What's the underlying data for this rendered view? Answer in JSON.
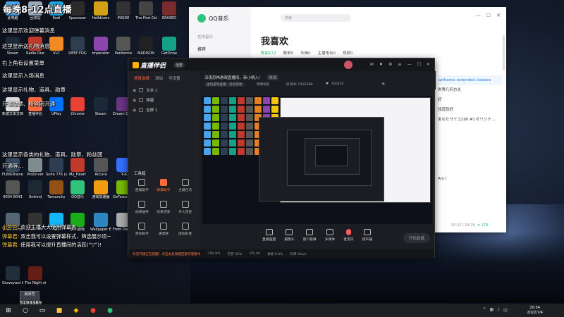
{
  "overlay": {
    "title": "每晚8-12点直播",
    "tips": [
      "这里显示欢迎弹幕消息",
      "这里显示送礼物消息",
      "右上角有设置菜单",
      "这里显示入场消息",
      "这里显示礼物、道具、勋章",
      "开通勋章、粉丝团开通",
      "这里显示各类的礼物、道具、勋章、粉丝团",
      "开通等…"
    ]
  },
  "desktop_icons": [
    {
      "label": "此电脑",
      "color": "#4aa3e8"
    },
    {
      "label": "回收站",
      "color": "#9aa8b8"
    },
    {
      "label": "Kodi",
      "color": "#1ba1e2"
    },
    {
      "label": "Spacewar",
      "color": "#2b2b2b"
    },
    {
      "label": "Helldivers",
      "color": "#d4a017"
    },
    {
      "label": "INSIDE",
      "color": "#333"
    },
    {
      "label": "The First Odyssey",
      "color": "#444"
    },
    {
      "label": "ERASED",
      "color": "#7a2b2b"
    },
    {
      "label": "Steam",
      "color": "#1b2838"
    },
    {
      "label": "Radio One",
      "color": "#c0392b"
    },
    {
      "label": "VLC",
      "color": "#f08a24"
    },
    {
      "label": "DEEP FOG",
      "color": "#2c3e50"
    },
    {
      "label": "Imperator",
      "color": "#8e44ad"
    },
    {
      "label": "Penitence",
      "color": "#555"
    },
    {
      "label": "MADISON",
      "color": "#222"
    },
    {
      "label": "GetOnne",
      "color": "#16a085"
    },
    {
      "label": "新建文本文档",
      "color": "#ddd"
    },
    {
      "label": "直播伴侣",
      "color": "#ff6a3d"
    },
    {
      "label": "UPlay",
      "color": "#0070ff"
    },
    {
      "label": "Chrome",
      "color": "#e94235"
    },
    {
      "label": "Steam",
      "color": "#1b2838"
    },
    {
      "label": "Dream Disorder",
      "color": "#6c3483"
    },
    {
      "label": "The Ghost",
      "color": "#444"
    },
    {
      "label": "优酷",
      "color": "#1e90ff"
    },
    {
      "label": "FLINGTrainer",
      "color": "#34495e"
    },
    {
      "label": "ProDriver",
      "color": "#7f8c8d"
    },
    {
      "label": "Suite 776 Launcher",
      "color": "#2c3e50"
    },
    {
      "label": "My_Heart",
      "color": "#c0392b"
    },
    {
      "label": "Accura",
      "color": "#555"
    },
    {
      "label": "飞书",
      "color": "#3370ff"
    },
    {
      "label": "YY直播",
      "color": "#f1c40f"
    },
    {
      "label": "UNITY",
      "color": "#222"
    },
    {
      "label": "8034 8043",
      "color": "#555"
    },
    {
      "label": "Unikind",
      "color": "#1c2833"
    },
    {
      "label": "Tamanchy",
      "color": "#935116"
    },
    {
      "label": "QQ音乐",
      "color": "#31c27c"
    },
    {
      "label": "游戏加速器",
      "color": "#f39c12"
    },
    {
      "label": "GeForce Experience",
      "color": "#76b900"
    },
    {
      "label": "Shadow Corridor",
      "color": "#2c3e50"
    },
    {
      "label": "恐怖游戏",
      "color": "#6e2c00"
    },
    {
      "label": "Toilet Chronicles",
      "color": "#566573"
    },
    {
      "label": "Ever Pre",
      "color": "#333"
    },
    {
      "label": "QQ",
      "color": "#12b7f5"
    },
    {
      "label": "腾讯游戏",
      "color": "#1aad19"
    },
    {
      "label": "Wallpaper Engine",
      "color": "#2e86c1"
    },
    {
      "label": "From Day To Day",
      "color": "#aaa"
    },
    {
      "label": "Shadows",
      "color": "#1c2833"
    },
    {
      "label": "Andromeda",
      "color": "#4a235a"
    },
    {
      "label": "Graveyard Incident",
      "color": "#212f3c"
    },
    {
      "label": "The Night of the Souls",
      "color": "#641e16"
    }
  ],
  "qq_music": {
    "app_name": "QQ音乐",
    "search_placeholder": "搜索",
    "sidebar_heading": "在线音乐",
    "sidebar_item": "推荐",
    "page_title": "我喜欢",
    "tabs": [
      "歌曲172",
      "歌单0",
      "专辑0",
      "主播电台0",
      "视频0"
    ],
    "songs": [
      "catharsis extended classics",
      "世界几何方长",
      "好",
      "知道就好",
      "あなたサイコ100 #] オリジナ…",
      "",
      "",
      "",
      "",
      "",
      "Am I"
    ],
    "time": "00:03 / 04:28",
    "count": "178"
  },
  "live_studio": {
    "brand": "直播伴侣",
    "pill": "连麦",
    "left_tabs": [
      "场景选择",
      "添加",
      "可设置"
    ],
    "scenes": [
      {
        "label": "文本 1"
      },
      {
        "label": "弹幕"
      },
      {
        "label": "全屏 1"
      }
    ],
    "toolbox_title": "工具箱",
    "tools": [
      {
        "label": "直播助手",
        "active": false
      },
      {
        "label": "弹幕助手",
        "active": true
      },
      {
        "label": "主播任务",
        "active": false
      },
      {
        "label": "福袋抽奖",
        "active": false
      },
      {
        "label": "玩家连麦",
        "active": false
      },
      {
        "label": "多人连麦",
        "active": false
      },
      {
        "label": "音效助手",
        "active": false
      },
      {
        "label": "语音聊",
        "active": false
      },
      {
        "label": "虚拟形象",
        "active": false
      }
    ],
    "title_input": "深夜恐怖游戏直播间，新小桃入！",
    "edit_label": "修改",
    "tag1": "主机游戏直播 - 全机游戏",
    "tag2": "修改标签",
    "room_label": "房间ID: 5193389",
    "fans": "100232",
    "bottom_buttons": [
      "直播画面",
      "摄像头",
      "窗口投屏",
      "多媒体",
      "麦克风",
      "扬声器"
    ],
    "start_button": "开始直播",
    "status": [
      "抖音开播正在提醒！点击此处观看回放可观看中",
      "CPU 8%",
      "内存 32%",
      "FPS 60",
      "丢帧 0.0%",
      "码率 0kb/s"
    ]
  },
  "chat": [
    {
      "nick": "小鱼鱼",
      "text": "欢迎主播大大使用弹幕秀"
    },
    {
      "nick": "弹幕君",
      "text": "双击我可以设置弹幕样式、筛选展示项~"
    },
    {
      "nick": "弹幕君",
      "text": "使用我可以提升直播间的活跃(°▽°)!"
    }
  ],
  "room": {
    "box_label": "房间号",
    "number": "5193389"
  },
  "taskbar": {
    "time": "20:54",
    "date": "2022/7/4"
  }
}
